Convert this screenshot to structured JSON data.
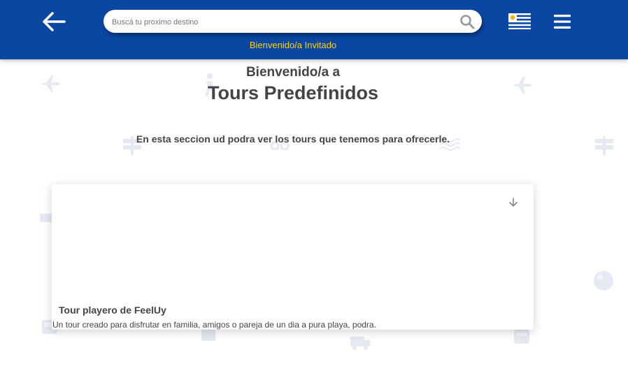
{
  "header": {
    "search_placeholder": "Buscá tu proximo destino",
    "welcome_user": "Bienvenido/a Invitado",
    "colors": {
      "bar": "#0a47a3",
      "welcome": "#ffd400"
    },
    "icons": [
      "back-arrow-icon",
      "search-icon",
      "uruguay-flag-icon",
      "hamburger-menu-icon"
    ]
  },
  "main": {
    "heading_small": "Bienvenido/a a",
    "heading_large": "Tours Predefinidos",
    "intro": "En esta seccion ud podra ver los tours que tenemos para ofrecerle."
  },
  "tours": [
    {
      "title": "Tour playero de FeelUy",
      "description": "Un tour creado para disfrutar en familia, amigos o pareja de un dia a pura playa, podra."
    }
  ]
}
